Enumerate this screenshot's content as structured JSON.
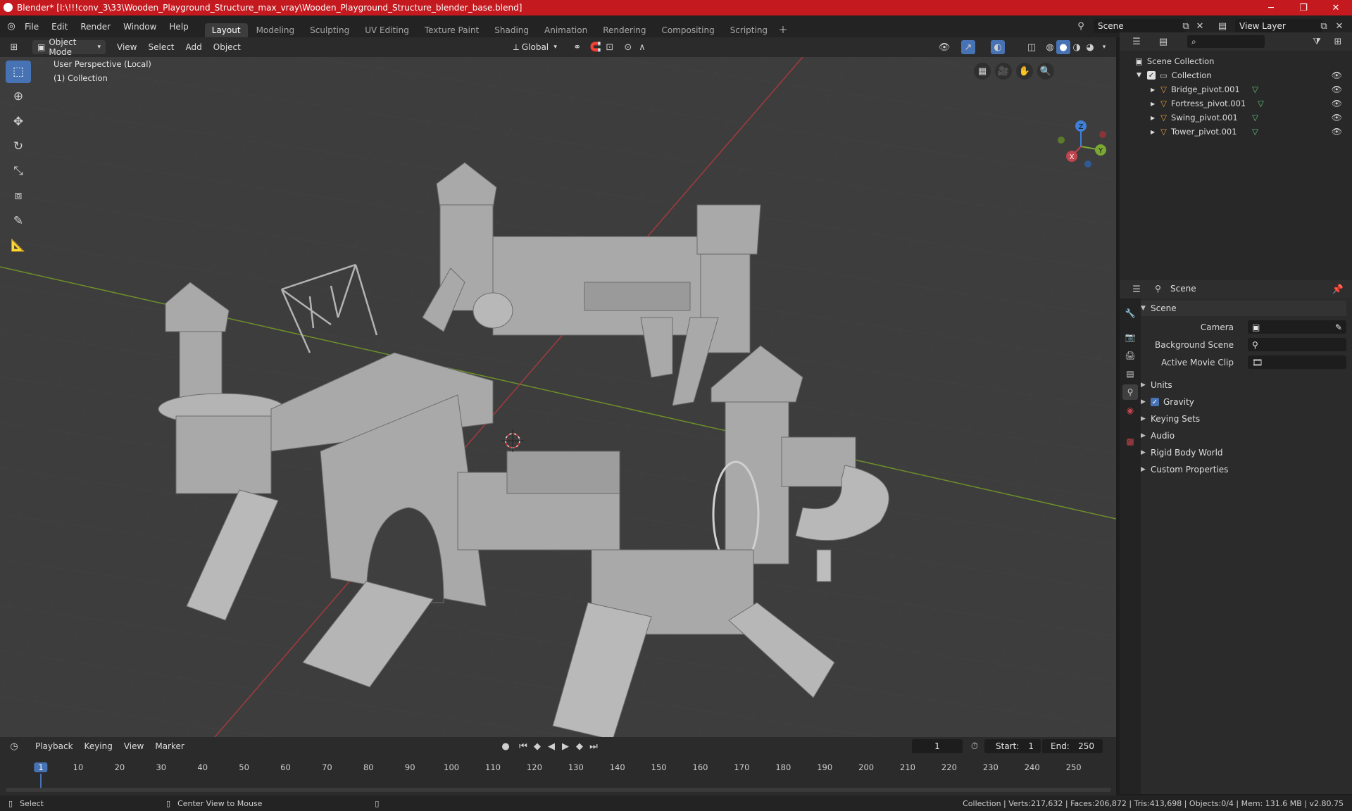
{
  "window": {
    "title": "Blender* [I:\\!!!conv_3\\33\\Wooden_Playground_Structure_max_vray\\Wooden_Playground_Structure_blender_base.blend]"
  },
  "menu": [
    "File",
    "Edit",
    "Render",
    "Window",
    "Help"
  ],
  "workspaces": [
    "Layout",
    "Modeling",
    "Sculpting",
    "UV Editing",
    "Texture Paint",
    "Shading",
    "Animation",
    "Rendering",
    "Compositing",
    "Scripting"
  ],
  "scene_field": "Scene",
  "view_layer_field": "View Layer",
  "viewport_header": {
    "mode": "Object Mode",
    "menus": [
      "View",
      "Select",
      "Add",
      "Object"
    ],
    "transform_orientation": "Global"
  },
  "viewport": {
    "perspective_label": "User Perspective (Local)",
    "collection_label": "(1) Collection",
    "gizmo": {
      "z": "Z",
      "y": "Y",
      "x": "X"
    }
  },
  "outliner": {
    "root": "Scene Collection",
    "collection": "Collection",
    "objects": [
      "Bridge_pivot.001",
      "Fortress_pivot.001",
      "Swing_pivot.001",
      "Tower_pivot.001"
    ]
  },
  "properties": {
    "header": "Scene",
    "scene_panel": "Scene",
    "fields": {
      "camera_label": "Camera",
      "background_label": "Background Scene",
      "movie_clip_label": "Active Movie Clip"
    },
    "panels": [
      "Units",
      "Gravity",
      "Keying Sets",
      "Audio",
      "Rigid Body World",
      "Custom Properties"
    ],
    "gravity_checked": true
  },
  "timeline": {
    "menus": [
      "Playback",
      "Keying",
      "View",
      "Marker"
    ],
    "current_frame": "1",
    "start_label": "Start:",
    "start_value": "1",
    "end_label": "End:",
    "end_value": "250",
    "ruler": [
      "1",
      "10",
      "20",
      "30",
      "40",
      "50",
      "60",
      "70",
      "80",
      "90",
      "100",
      "110",
      "120",
      "130",
      "140",
      "150",
      "160",
      "170",
      "180",
      "190",
      "200",
      "210",
      "220",
      "230",
      "240",
      "250"
    ]
  },
  "statusbar": {
    "select": "Select",
    "center_view": "Center View to Mouse",
    "stats": "Collection | Verts:217,632 | Faces:206,872 | Tris:413,698 | Objects:0/4 | Mem: 131.6 MB | v2.80.75"
  },
  "colors": {
    "title_bar": "#c4191e",
    "accent": "#4772b3",
    "x_axis": "#c2444c",
    "y_axis": "#7aa832",
    "z_axis": "#3f7fd6"
  }
}
